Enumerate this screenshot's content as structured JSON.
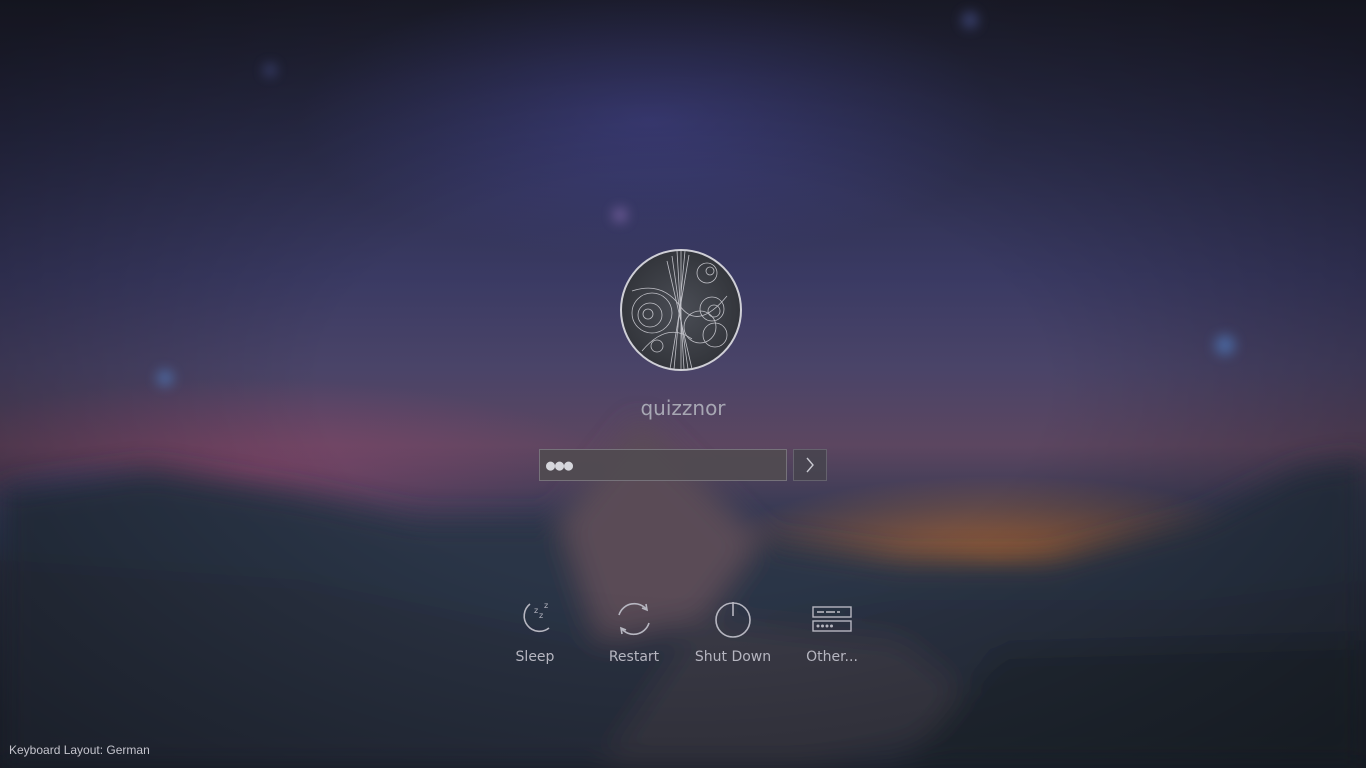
{
  "login": {
    "username": "quizznor",
    "password_masked": "●●●"
  },
  "actions": [
    {
      "id": "sleep",
      "label": "Sleep",
      "icon": "sleep-moon-icon"
    },
    {
      "id": "restart",
      "label": "Restart",
      "icon": "restart-icon"
    },
    {
      "id": "shutdown",
      "label": "Shut Down",
      "icon": "power-icon"
    },
    {
      "id": "other",
      "label": "Other...",
      "icon": "other-user-icon"
    }
  ],
  "footer": {
    "keyboard_layout": "Keyboard Layout: German"
  },
  "colors": {
    "label_text": "#b6b6c0",
    "input_bg": "#504b50",
    "horizon_orange": "#c46e2d"
  }
}
